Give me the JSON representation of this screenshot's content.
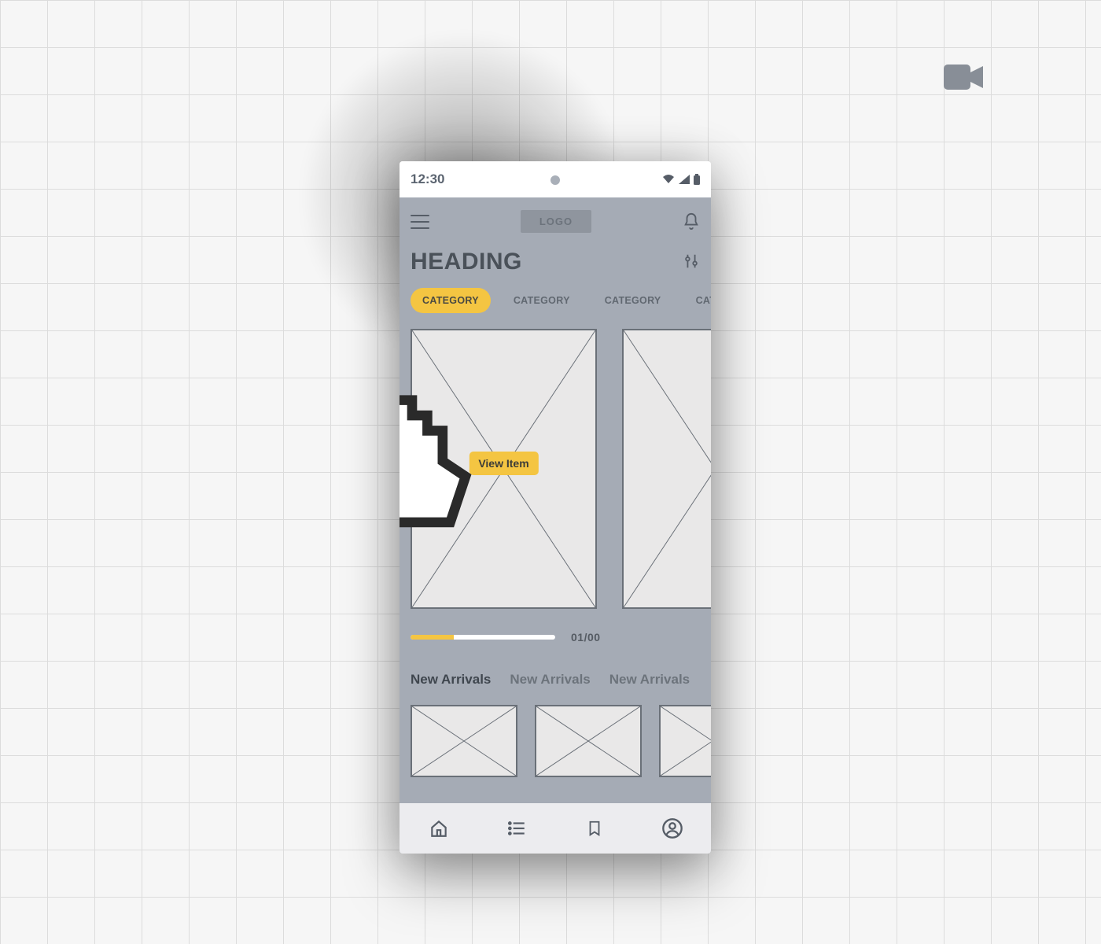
{
  "statusbar": {
    "time": "12:30"
  },
  "topbar": {
    "logo": "LOGO"
  },
  "heading": "HEADING",
  "tabs": [
    {
      "label": "CATEGORY",
      "active": true
    },
    {
      "label": "CATEGORY",
      "active": false
    },
    {
      "label": "CATEGORY",
      "active": false
    },
    {
      "label": "CATEGORY",
      "active": false
    }
  ],
  "card": {
    "view_button": "View Item"
  },
  "progress": {
    "text": "01/00",
    "fill_pct": 30
  },
  "new_arrivals_tabs": [
    {
      "label": "New Arrivals",
      "active": true
    },
    {
      "label": "New Arrivals",
      "active": false
    },
    {
      "label": "New Arrivals",
      "active": false
    }
  ],
  "colors": {
    "accent": "#f4c542",
    "text": "#565d67",
    "surface": "#a5abb5"
  }
}
